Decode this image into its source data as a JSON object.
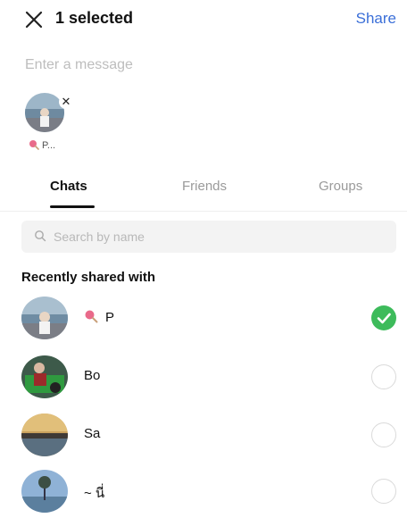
{
  "header": {
    "title": "1 selected",
    "share_label": "Share"
  },
  "message": {
    "placeholder": "Enter a message",
    "value": ""
  },
  "selected": [
    {
      "name": "P..."
    }
  ],
  "tabs": [
    {
      "label": "Chats",
      "active": true
    },
    {
      "label": "Friends",
      "active": false
    },
    {
      "label": "Groups",
      "active": false
    }
  ],
  "search": {
    "placeholder": "Search by name"
  },
  "section_title": "Recently shared with",
  "contacts": [
    {
      "name": "P",
      "checked": true
    },
    {
      "name": "Bo",
      "checked": false
    },
    {
      "name": "Sa",
      "checked": false
    },
    {
      "name": "~ นี่",
      "checked": false
    }
  ],
  "colors": {
    "accent_blue": "#3b6fd8",
    "check_green": "#3dbb5b"
  }
}
